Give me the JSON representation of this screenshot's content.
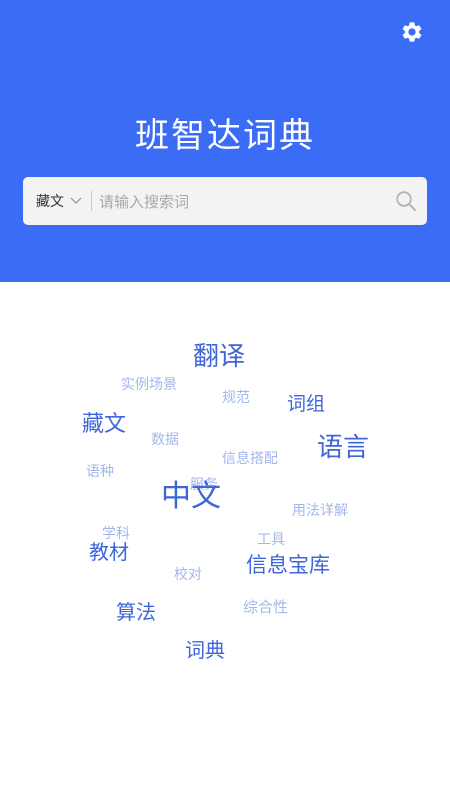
{
  "header": {
    "title": "班智达词典",
    "settings_icon": "gear-icon"
  },
  "search": {
    "language": "藏文",
    "placeholder": "请输入搜索词",
    "value": ""
  },
  "colors": {
    "header_bg": "#3b6cf6",
    "tag_strong": "#3f66d9",
    "tag_light": "#a3b7ec"
  },
  "word_cloud": {
    "words": [
      {
        "id": "fanyi",
        "text": "翻译"
      },
      {
        "id": "shilichangjing",
        "text": "实例场景"
      },
      {
        "id": "guifan",
        "text": "规范"
      },
      {
        "id": "cizu",
        "text": "词组"
      },
      {
        "id": "zangwen",
        "text": "藏文"
      },
      {
        "id": "shuju",
        "text": "数据"
      },
      {
        "id": "yuyan",
        "text": "语言"
      },
      {
        "id": "xinxidapei",
        "text": "信息搭配"
      },
      {
        "id": "yuzhong",
        "text": "语种"
      },
      {
        "id": "fuwu",
        "text": "服务"
      },
      {
        "id": "zhongwen",
        "text": "中文"
      },
      {
        "id": "yongfaxiangjie",
        "text": "用法详解"
      },
      {
        "id": "xueke",
        "text": "学科"
      },
      {
        "id": "jiaocai",
        "text": "教材"
      },
      {
        "id": "gongju",
        "text": "工具"
      },
      {
        "id": "xinxibaoku",
        "text": "信息宝库"
      },
      {
        "id": "jiaodui",
        "text": "校对"
      },
      {
        "id": "suanfa",
        "text": "算法"
      },
      {
        "id": "zonghexing",
        "text": "综合性"
      },
      {
        "id": "cidian",
        "text": "词典"
      }
    ]
  }
}
